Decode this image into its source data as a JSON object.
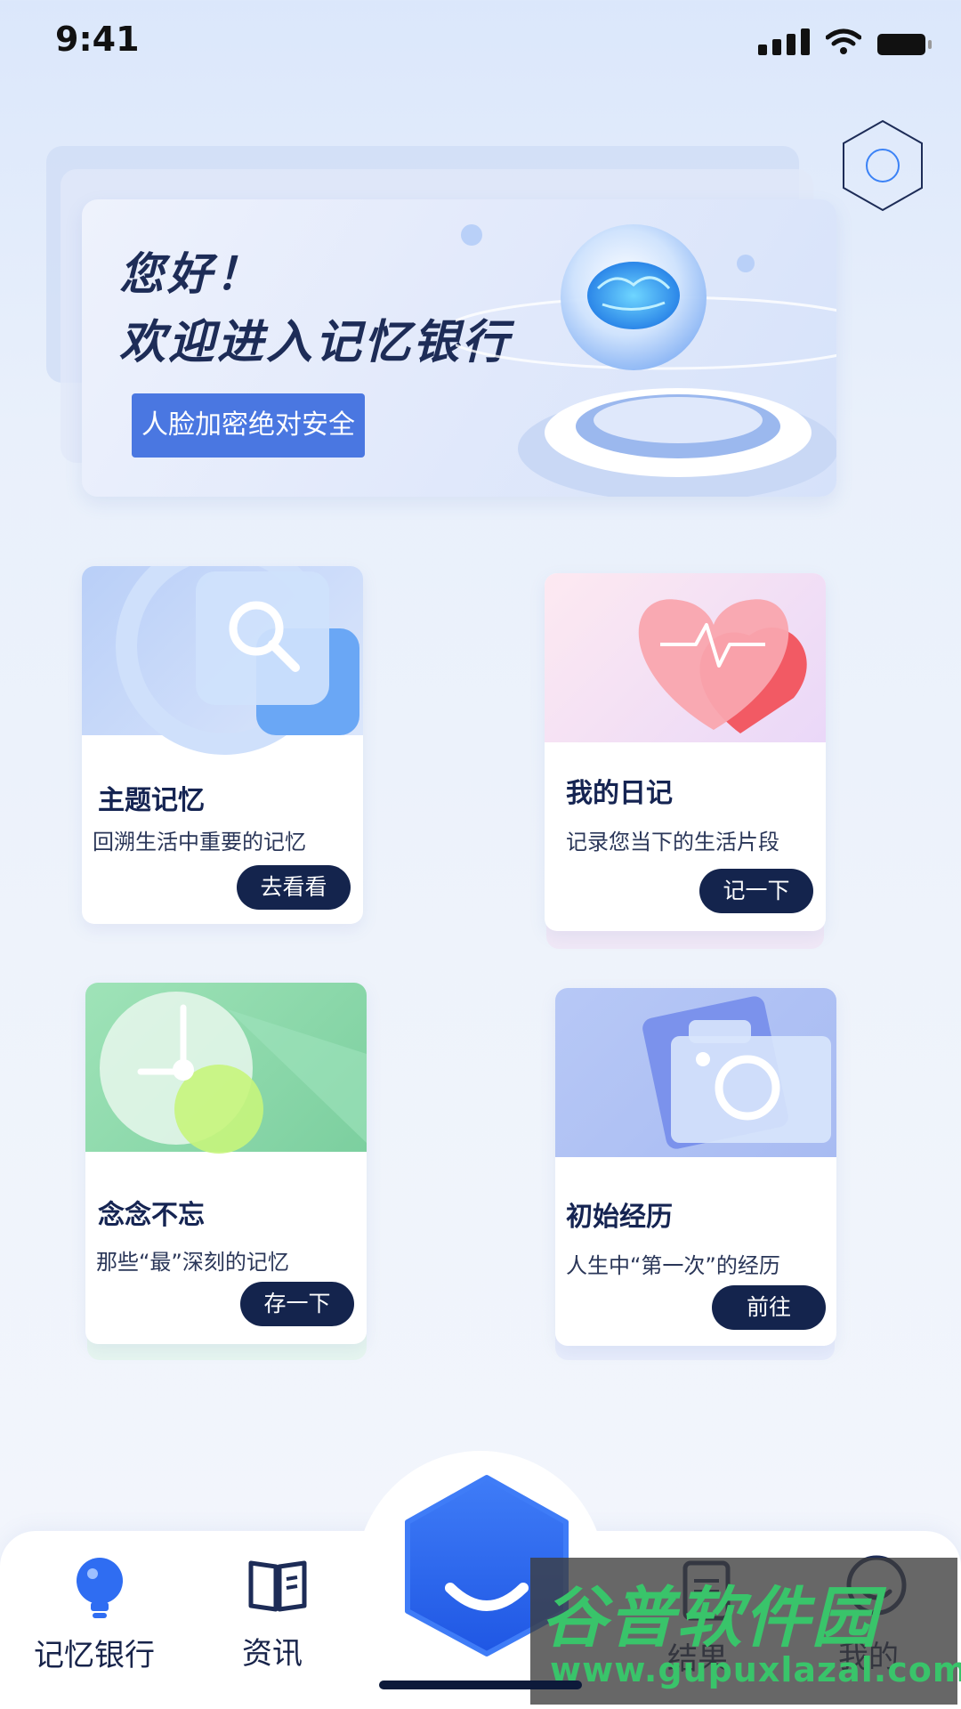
{
  "status_bar": {
    "time": "9:41"
  },
  "banner": {
    "line1": "您好！",
    "line2": "欢迎进入记忆银行",
    "button": "人脸加密绝对安全"
  },
  "cards": [
    {
      "title": "主题记忆",
      "subtitle": "回溯生活中重要的记忆",
      "button": "去看看",
      "icon": "search-icon",
      "accent": "#8fb4f8"
    },
    {
      "title": "我的日记",
      "subtitle": "记录您当下的生活片段",
      "button": "记一下",
      "icon": "heart-pulse-icon",
      "accent": "#f58b98"
    },
    {
      "title": "念念不忘",
      "subtitle": "那些“最”深刻的记忆",
      "button": "存一下",
      "icon": "clock-icon",
      "accent": "#8fd9a8"
    },
    {
      "title": "初始经历",
      "subtitle": "人生中“第一次”的经历",
      "button": "前往",
      "icon": "camera-icon",
      "accent": "#a7b9f2"
    }
  ],
  "tabbar": {
    "items": [
      {
        "label": "记忆银行",
        "icon": "bulb-icon",
        "active": true
      },
      {
        "label": "资讯",
        "icon": "book-icon",
        "active": false
      },
      {
        "label": "",
        "icon": "smile-hex-icon",
        "active": false
      },
      {
        "label": "结果",
        "icon": "document-icon",
        "active": false
      },
      {
        "label": "我的",
        "icon": "profile-icon",
        "active": false
      }
    ]
  },
  "watermark": {
    "line1": "谷普软件园",
    "line2": "www.gupuxlazal.com"
  },
  "colors": {
    "primary": "#4a77e1",
    "dark": "#14244d",
    "tab_active": "#2f6df2"
  }
}
